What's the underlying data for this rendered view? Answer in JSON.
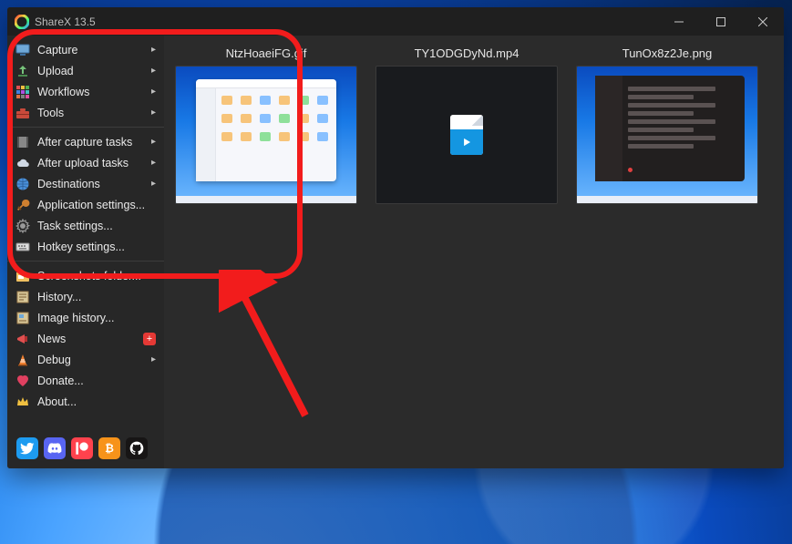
{
  "titlebar": {
    "title": "ShareX 13.5"
  },
  "sidebar": {
    "group1": [
      {
        "label": "Capture",
        "icon": "monitor",
        "submenu": true
      },
      {
        "label": "Upload",
        "icon": "upload",
        "submenu": true
      },
      {
        "label": "Workflows",
        "icon": "grid-color",
        "submenu": true
      },
      {
        "label": "Tools",
        "icon": "toolbox",
        "submenu": true
      }
    ],
    "group2": [
      {
        "label": "After capture tasks",
        "icon": "film",
        "submenu": true
      },
      {
        "label": "After upload tasks",
        "icon": "cloud",
        "submenu": true
      },
      {
        "label": "Destinations",
        "icon": "globe",
        "submenu": true
      },
      {
        "label": "Application settings...",
        "icon": "wrench",
        "submenu": false
      },
      {
        "label": "Task settings...",
        "icon": "gear",
        "submenu": false
      },
      {
        "label": "Hotkey settings...",
        "icon": "keyboard",
        "submenu": false
      }
    ],
    "group3": [
      {
        "label": "Screenshots folder...",
        "icon": "folder",
        "submenu": false
      },
      {
        "label": "History...",
        "icon": "history",
        "submenu": false
      },
      {
        "label": "Image history...",
        "icon": "image-history",
        "submenu": false
      },
      {
        "label": "News",
        "icon": "megaphone",
        "submenu": false,
        "badge": "+"
      },
      {
        "label": "Debug",
        "icon": "cone",
        "submenu": true
      },
      {
        "label": "Donate...",
        "icon": "heart",
        "submenu": false
      },
      {
        "label": "About...",
        "icon": "crown",
        "submenu": false
      }
    ]
  },
  "social": [
    "twitter",
    "discord",
    "patreon",
    "bitcoin",
    "github"
  ],
  "thumbnails": [
    {
      "filename": "NtzHoaeiFG.gif"
    },
    {
      "filename": "TY1ODGDyNd.mp4"
    },
    {
      "filename": "TunOx8z2Je.png"
    }
  ],
  "colors": {
    "annotation": "#f21c1c",
    "twitter": "#1d9bf0",
    "discord": "#5865f2",
    "patreon": "#ff424d",
    "bitcoin": "#f7931a",
    "github": "#171515"
  }
}
